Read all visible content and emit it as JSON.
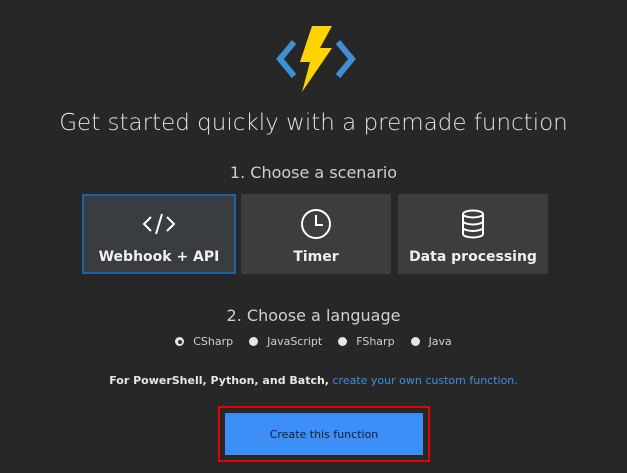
{
  "header": {
    "logo": "azure-functions-bolt-icon",
    "headline": "Get started quickly with a premade function"
  },
  "step1": {
    "title": "1. Choose a scenario",
    "scenarios": [
      {
        "label": "Webhook + API",
        "icon": "code-brackets-icon",
        "selected": true
      },
      {
        "label": "Timer",
        "icon": "clock-icon",
        "selected": false
      },
      {
        "label": "Data processing",
        "icon": "database-icon",
        "selected": false
      }
    ]
  },
  "step2": {
    "title": "2. Choose a language",
    "languages": [
      {
        "label": "CSharp",
        "selected": true
      },
      {
        "label": "JavaScript",
        "selected": false
      },
      {
        "label": "FSharp",
        "selected": false
      },
      {
        "label": "Java",
        "selected": false
      }
    ]
  },
  "note": {
    "text": "For PowerShell, Python, and Batch,",
    "link": "create your own custom function."
  },
  "create_button": "Create this function",
  "colors": {
    "background": "#272727",
    "accent": "#3d8ef7",
    "selected_border": "#1b63a5",
    "highlight": "#e00000",
    "bolt": "#ffd400",
    "brackets": "#3e8fd4"
  }
}
